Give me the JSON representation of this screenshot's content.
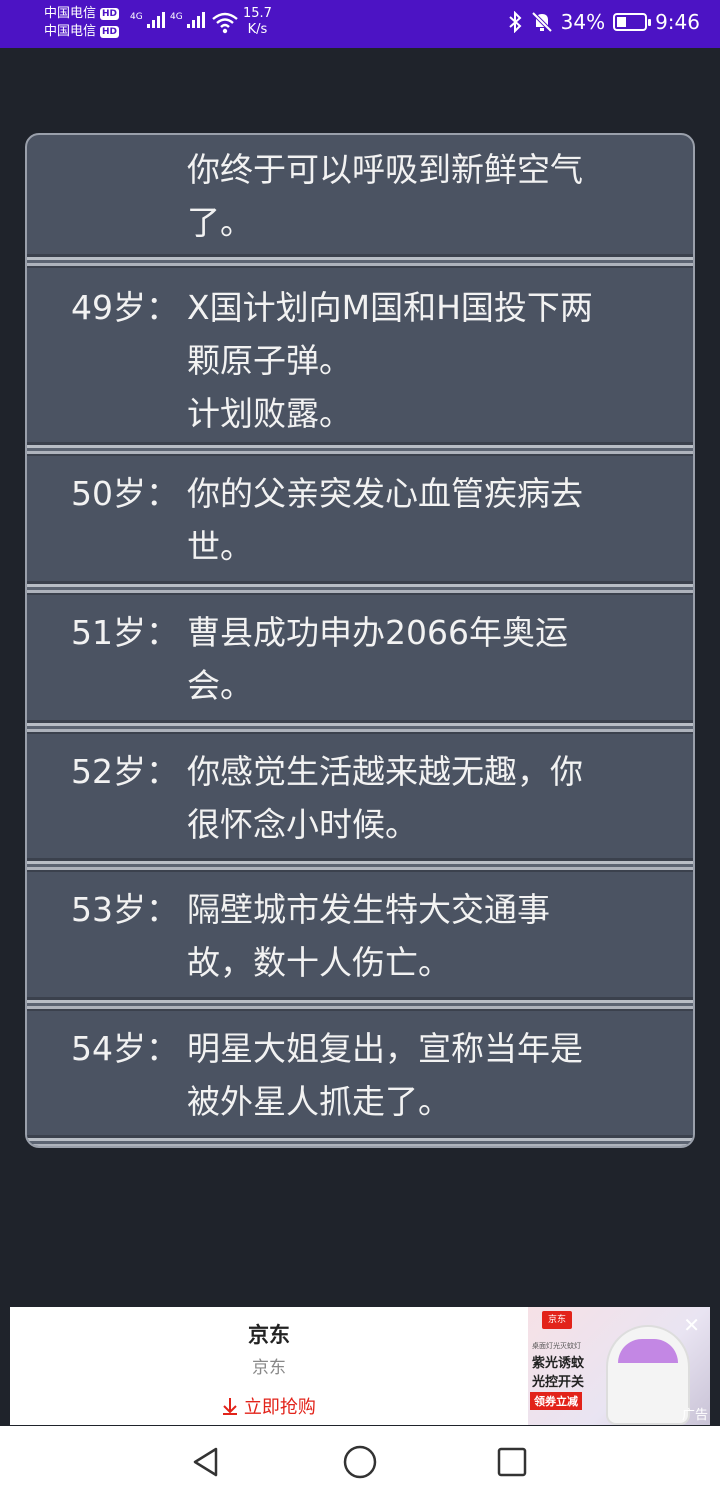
{
  "status_bar": {
    "carrier1": "中国电信",
    "carrier2": "中国电信",
    "hd": "HD",
    "network1": "4G",
    "network2": "4G",
    "speed_value": "15.7",
    "speed_unit": "K/s",
    "battery_level": 34,
    "battery": "34%",
    "time": "9:46",
    "accent_color": "#4c13c4"
  },
  "events": [
    {
      "age": "",
      "text": "你终于可以呼吸到新鲜空气\n了。"
    },
    {
      "age": "49岁：",
      "text": "X国计划向M国和H国投下两\n颗原子弹。\n计划败露。"
    },
    {
      "age": "50岁：",
      "text": "你的父亲突发心血管疾病去\n世。"
    },
    {
      "age": "51岁：",
      "text": "曹县成功申办2066年奥运\n会。"
    },
    {
      "age": "52岁：",
      "text": "你感觉生活越来越无趣，你\n很怀念小时候。"
    },
    {
      "age": "53岁：",
      "text": "隔壁城市发生特大交通事\n故，数十人伤亡。"
    },
    {
      "age": "54岁：",
      "text": "明星大姐复出，宣称当年是\n被外星人抓走了。"
    }
  ],
  "ad": {
    "title": "京东",
    "subtitle": "京东",
    "cta": "立即抢购",
    "image_logo": "京东",
    "image_tagline": "桌面灯光灭蚊灯",
    "image_line1": "紫光诱蚊",
    "image_line2": "光控开关",
    "image_promo": "领券立减",
    "label": "广告",
    "close_icon": "close-icon"
  }
}
